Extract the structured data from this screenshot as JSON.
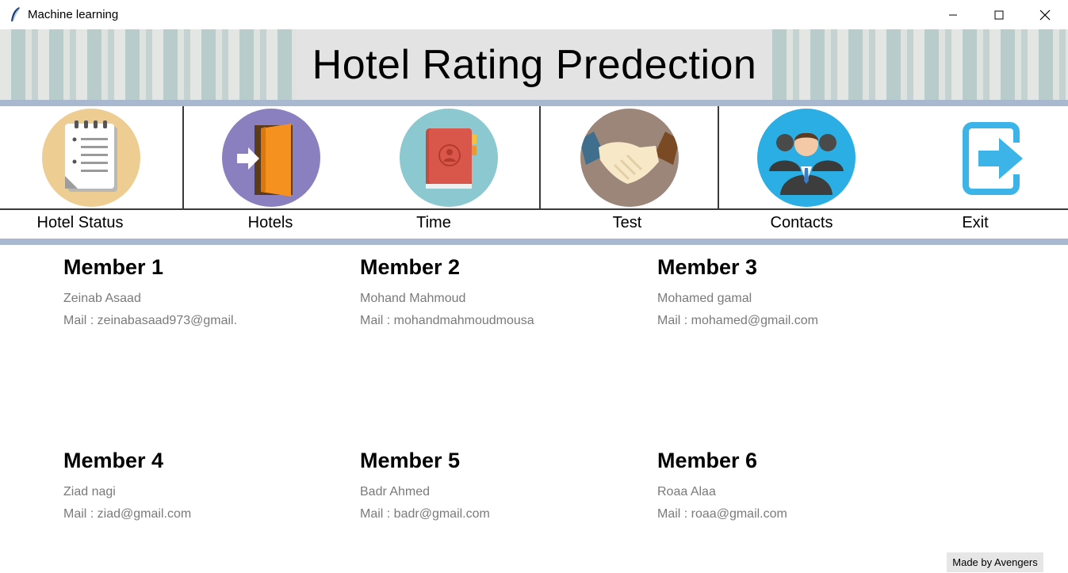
{
  "window": {
    "title": "Machine learning",
    "controls": {
      "minimize": "minimize",
      "maximize": "maximize",
      "close": "close"
    }
  },
  "header": {
    "title": "Hotel Rating Predection"
  },
  "nav": {
    "items": [
      {
        "label": "Hotel Status",
        "icon": "notepad-icon",
        "color": "#EECD93"
      },
      {
        "label": "Hotels",
        "icon": "door-enter-icon",
        "color": "#8A7FBF"
      },
      {
        "label": "Time",
        "icon": "book-icon",
        "color": "#8BC8D0"
      },
      {
        "label": "Test",
        "icon": "handshake-icon",
        "color": "#9C8579"
      },
      {
        "label": "Contacts",
        "icon": "team-icon",
        "color": "#2BAEE3"
      },
      {
        "label": "Exit",
        "icon": "exit-icon",
        "color": "#3DB4E8"
      }
    ]
  },
  "members": [
    {
      "heading": "Member 1",
      "name": "Zeinab Asaad",
      "mail": "Mail : zeinabasaad973@gmail."
    },
    {
      "heading": "Member 2",
      "name": "Mohand Mahmoud",
      "mail": "Mail : mohandmahmoudmousa"
    },
    {
      "heading": "Member 3",
      "name": "Mohamed gamal",
      "mail": "Mail : mohamed@gmail.com"
    },
    {
      "heading": "Member 4",
      "name": "Ziad nagi",
      "mail": "Mail : ziad@gmail.com"
    },
    {
      "heading": "Member 5",
      "name": "Badr Ahmed",
      "mail": "Mail : badr@gmail.com"
    },
    {
      "heading": "Member 6",
      "name": "Roaa Alaa",
      "mail": "Mail : roaa@gmail.com"
    }
  ],
  "footer": {
    "badge": "Made by Avengers"
  },
  "colors": {
    "accent_rule": "#a8b9cf",
    "banner_center": "#e3e3e3"
  }
}
